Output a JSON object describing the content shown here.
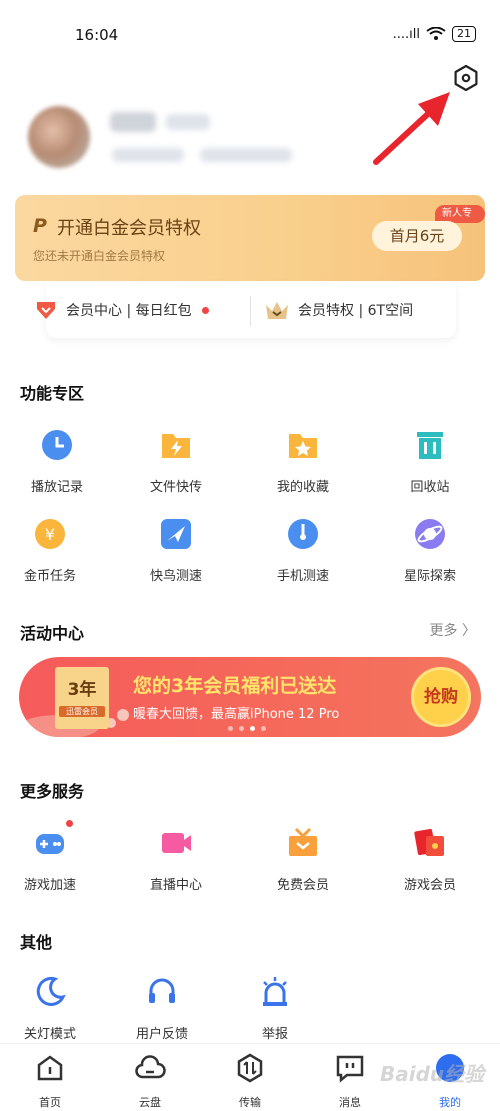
{
  "status_bar": {
    "time": "16:04",
    "signal": "....ıll",
    "battery": "21"
  },
  "vip": {
    "logo": "P",
    "title": "开通白金会员特权",
    "subtitle": "您还未开通白金会员特权",
    "badge": "新人专享",
    "price": "首月6元"
  },
  "member_strip": {
    "left": "会员中心 | 每日红包",
    "right": "会员特权 | 6T空间"
  },
  "features": {
    "title": "功能专区",
    "items": [
      {
        "label": "播放记录",
        "icon": "clock-icon"
      },
      {
        "label": "文件快传",
        "icon": "lightning-folder-icon"
      },
      {
        "label": "我的收藏",
        "icon": "star-folder-icon"
      },
      {
        "label": "回收站",
        "icon": "trash-icon"
      },
      {
        "label": "金币任务",
        "icon": "coin-icon"
      },
      {
        "label": "快鸟测速",
        "icon": "bird-icon"
      },
      {
        "label": "手机测速",
        "icon": "speedometer-icon"
      },
      {
        "label": "星际探索",
        "icon": "planet-icon"
      }
    ]
  },
  "activity": {
    "title": "活动中心",
    "more": "更多 〉",
    "banner": {
      "year": "3年",
      "year_sub": "迅雷会员",
      "title": "您的3年会员福利已送达",
      "subtitle": "暖春大回馈，最高赢iPhone 12 Pro",
      "button": "抢购"
    }
  },
  "services": {
    "title": "更多服务",
    "items": [
      {
        "label": "游戏加速",
        "icon": "gamepad-icon"
      },
      {
        "label": "直播中心",
        "icon": "video-camera-icon"
      },
      {
        "label": "免费会员",
        "icon": "gift-box-icon"
      },
      {
        "label": "游戏会员",
        "icon": "red-envelope-icon"
      }
    ]
  },
  "other": {
    "title": "其他",
    "items": [
      {
        "label": "关灯模式",
        "icon": "moon-icon"
      },
      {
        "label": "用户反馈",
        "icon": "headset-icon"
      },
      {
        "label": "举报",
        "icon": "alarm-icon"
      }
    ]
  },
  "tabbar": {
    "items": [
      {
        "label": "首页",
        "icon": "home-icon"
      },
      {
        "label": "云盘",
        "icon": "cloud-icon"
      },
      {
        "label": "传输",
        "icon": "transfer-icon"
      },
      {
        "label": "消息",
        "icon": "message-icon"
      },
      {
        "label": "我的",
        "icon": "profile-icon"
      }
    ],
    "active_index": 4
  },
  "watermark": "Baidu经验",
  "colors": {
    "accent": "#2e6cf0",
    "vip_gold": "#f9cf8c",
    "banner_red": "#f55b5b",
    "arrow_red": "#e8252d"
  }
}
